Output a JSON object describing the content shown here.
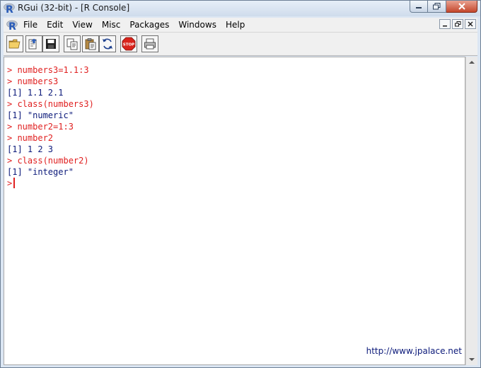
{
  "window": {
    "title": "RGui (32-bit) - [R Console]",
    "logo_letter": "R"
  },
  "menubar": {
    "items": [
      "File",
      "Edit",
      "View",
      "Misc",
      "Packages",
      "Windows",
      "Help"
    ]
  },
  "toolbar": {
    "buttons": [
      {
        "name": "open-script-icon"
      },
      {
        "name": "load-workspace-icon"
      },
      {
        "name": "save-workspace-icon"
      },
      {
        "name": "copy-icon"
      },
      {
        "name": "paste-icon"
      },
      {
        "name": "copy-paste-icon"
      },
      {
        "name": "stop-icon",
        "text": "STOP"
      },
      {
        "name": "print-icon"
      }
    ]
  },
  "console": {
    "lines": [
      {
        "type": "input",
        "text": "> numbers3=1.1:3"
      },
      {
        "type": "input",
        "text": "> numbers3"
      },
      {
        "type": "output",
        "text": "[1] 1.1 2.1"
      },
      {
        "type": "input",
        "text": "> class(numbers3)"
      },
      {
        "type": "output",
        "text": "[1] \"numeric\""
      },
      {
        "type": "input",
        "text": "> number2=1:3"
      },
      {
        "type": "input",
        "text": "> number2"
      },
      {
        "type": "output",
        "text": "[1] 1 2 3"
      },
      {
        "type": "input",
        "text": "> class(number2)"
      },
      {
        "type": "output",
        "text": "[1] \"integer\""
      }
    ],
    "prompt": ">",
    "watermark": "http://www.jpalace.net"
  },
  "colors": {
    "input_text": "#e02020",
    "output_text": "#0c1a7a",
    "console_bg": "#ffffff",
    "stop_red": "#d9231b"
  }
}
